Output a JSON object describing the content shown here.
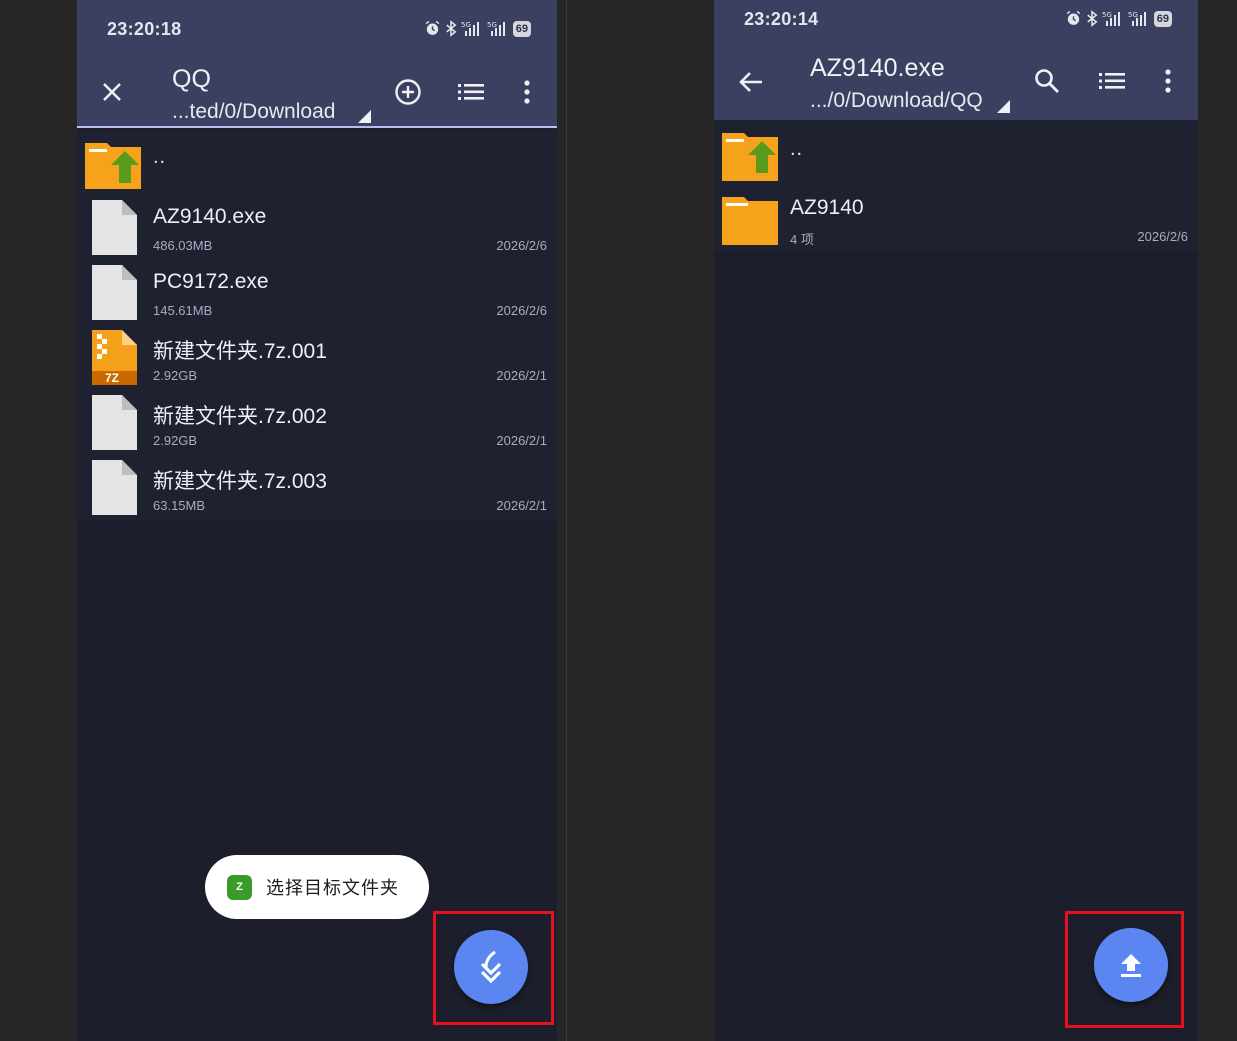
{
  "left_phone": {
    "status": {
      "time": "23:20:18",
      "battery": "69"
    },
    "appbar": {
      "title": "QQ",
      "path": "...ted/0/Download"
    },
    "files": [
      {
        "kind": "parent",
        "name": ".."
      },
      {
        "kind": "file",
        "name": "AZ9140.exe",
        "meta": "486.03MB",
        "date": "2026/2/6"
      },
      {
        "kind": "file",
        "name": "PC9172.exe",
        "meta": "145.61MB",
        "date": "2026/2/6"
      },
      {
        "kind": "archive",
        "name": "新建文件夹.7z.001",
        "meta": "2.92GB",
        "date": "2026/2/1"
      },
      {
        "kind": "file",
        "name": "新建文件夹.7z.002",
        "meta": "2.92GB",
        "date": "2026/2/1"
      },
      {
        "kind": "file",
        "name": "新建文件夹.7z.003",
        "meta": "63.15MB",
        "date": "2026/2/1"
      }
    ],
    "archive_badge": "7Z",
    "toast": {
      "logo": "Z",
      "text": "选择目标文件夹"
    },
    "fab_icon": "extract-icon"
  },
  "right_phone": {
    "status": {
      "time": "23:20:14",
      "battery": "69"
    },
    "appbar": {
      "title": "AZ9140.exe",
      "path": ".../0/Download/QQ"
    },
    "files": [
      {
        "kind": "parent",
        "name": ".."
      },
      {
        "kind": "folder",
        "name": "AZ9140",
        "meta": "4 项",
        "date": "2026/2/6"
      }
    ],
    "fab_icon": "upload-icon"
  },
  "colors": {
    "accent": "#5b86f2",
    "appbar": "#3b4060",
    "list_bg": "#1e2130",
    "folder": "#f7a21b",
    "highlight": "#e8101c"
  }
}
